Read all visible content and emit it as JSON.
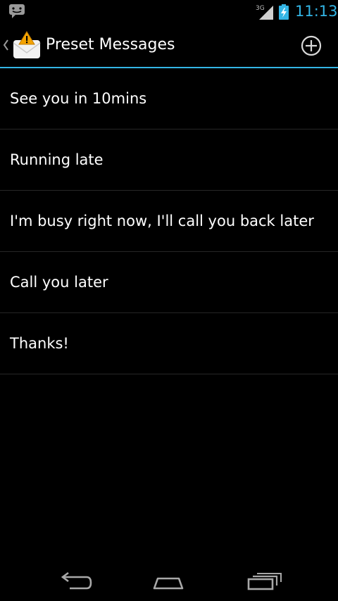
{
  "status_bar": {
    "notification_icon": "messaging-notification-icon",
    "network_label": "3G",
    "signal_icon": "signal-icon",
    "battery_icon": "battery-charging-icon",
    "time": "11:13",
    "clock_color": "#33b5e5"
  },
  "action_bar": {
    "up_icon": "up-caret-icon",
    "app_icon": "message-alert-icon",
    "title": "Preset Messages",
    "add_icon": "plus-circle-icon",
    "accent_color": "#33b5e5"
  },
  "messages": [
    "See you in 10mins",
    "Running late",
    "I'm busy right now, I'll call you back later",
    "Call you later",
    "Thanks!"
  ],
  "nav_bar": {
    "back_icon": "back-icon",
    "home_icon": "home-icon",
    "recents_icon": "recent-apps-icon"
  }
}
